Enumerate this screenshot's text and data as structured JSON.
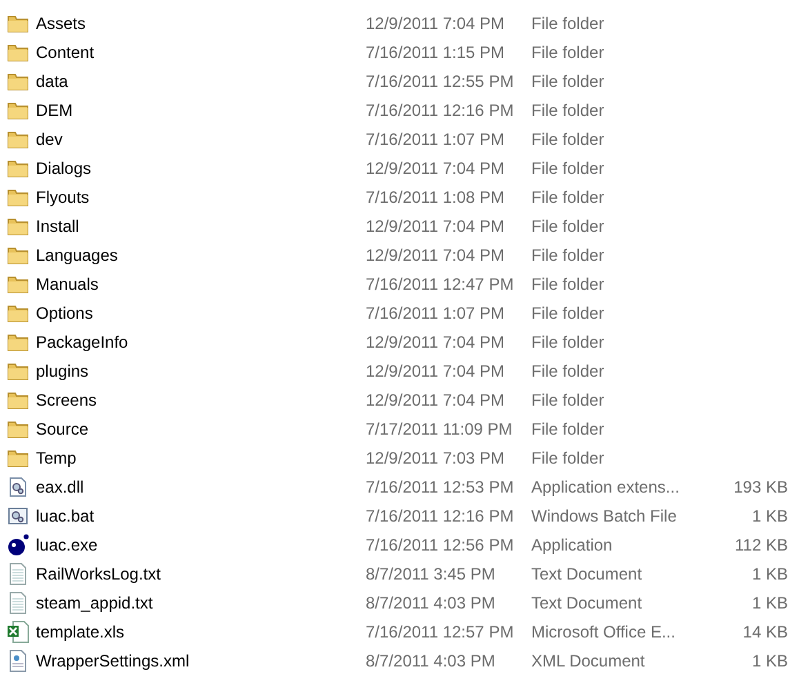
{
  "files": [
    {
      "name": "Assets",
      "date": "12/9/2011 7:04 PM",
      "type": "File folder",
      "kind": "folder"
    },
    {
      "name": "Content",
      "date": "7/16/2011 1:15 PM",
      "type": "File folder",
      "kind": "folder"
    },
    {
      "name": "data",
      "date": "7/16/2011 12:55 PM",
      "type": "File folder",
      "kind": "folder"
    },
    {
      "name": "DEM",
      "date": "7/16/2011 12:16 PM",
      "type": "File folder",
      "kind": "folder"
    },
    {
      "name": "dev",
      "date": "7/16/2011 1:07 PM",
      "type": "File folder",
      "kind": "folder"
    },
    {
      "name": "Dialogs",
      "date": "12/9/2011 7:04 PM",
      "type": "File folder",
      "kind": "folder"
    },
    {
      "name": "Flyouts",
      "date": "7/16/2011 1:08 PM",
      "type": "File folder",
      "kind": "folder"
    },
    {
      "name": "Install",
      "date": "12/9/2011 7:04 PM",
      "type": "File folder",
      "kind": "folder"
    },
    {
      "name": "Languages",
      "date": "12/9/2011 7:04 PM",
      "type": "File folder",
      "kind": "folder"
    },
    {
      "name": "Manuals",
      "date": "7/16/2011 12:47 PM",
      "type": "File folder",
      "kind": "folder"
    },
    {
      "name": "Options",
      "date": "7/16/2011 1:07 PM",
      "type": "File folder",
      "kind": "folder"
    },
    {
      "name": "PackageInfo",
      "date": "12/9/2011 7:04 PM",
      "type": "File folder",
      "kind": "folder"
    },
    {
      "name": "plugins",
      "date": "12/9/2011 7:04 PM",
      "type": "File folder",
      "kind": "folder"
    },
    {
      "name": "Screens",
      "date": "12/9/2011 7:04 PM",
      "type": "File folder",
      "kind": "folder"
    },
    {
      "name": "Source",
      "date": "7/17/2011 11:09 PM",
      "type": "File folder",
      "kind": "folder"
    },
    {
      "name": "Temp",
      "date": "12/9/2011 7:03 PM",
      "type": "File folder",
      "kind": "folder"
    },
    {
      "name": "eax.dll",
      "date": "7/16/2011 12:53 PM",
      "type": "Application extens...",
      "size": "193 KB",
      "kind": "dll"
    },
    {
      "name": "luac.bat",
      "date": "7/16/2011 12:16 PM",
      "type": "Windows Batch File",
      "size": "1 KB",
      "kind": "bat"
    },
    {
      "name": "luac.exe",
      "date": "7/16/2011 12:56 PM",
      "type": "Application",
      "size": "112 KB",
      "kind": "exe"
    },
    {
      "name": "RailWorksLog.txt",
      "date": "8/7/2011 3:45 PM",
      "type": "Text Document",
      "size": "1 KB",
      "kind": "text"
    },
    {
      "name": "steam_appid.txt",
      "date": "8/7/2011 4:03 PM",
      "type": "Text Document",
      "size": "1 KB",
      "kind": "text"
    },
    {
      "name": "template.xls",
      "date": "7/16/2011 12:57 PM",
      "type": "Microsoft Office E...",
      "size": "14 KB",
      "kind": "sheet"
    },
    {
      "name": "WrapperSettings.xml",
      "date": "8/7/2011 4:03 PM",
      "type": "XML Document",
      "size": "1 KB",
      "kind": "xml"
    }
  ]
}
